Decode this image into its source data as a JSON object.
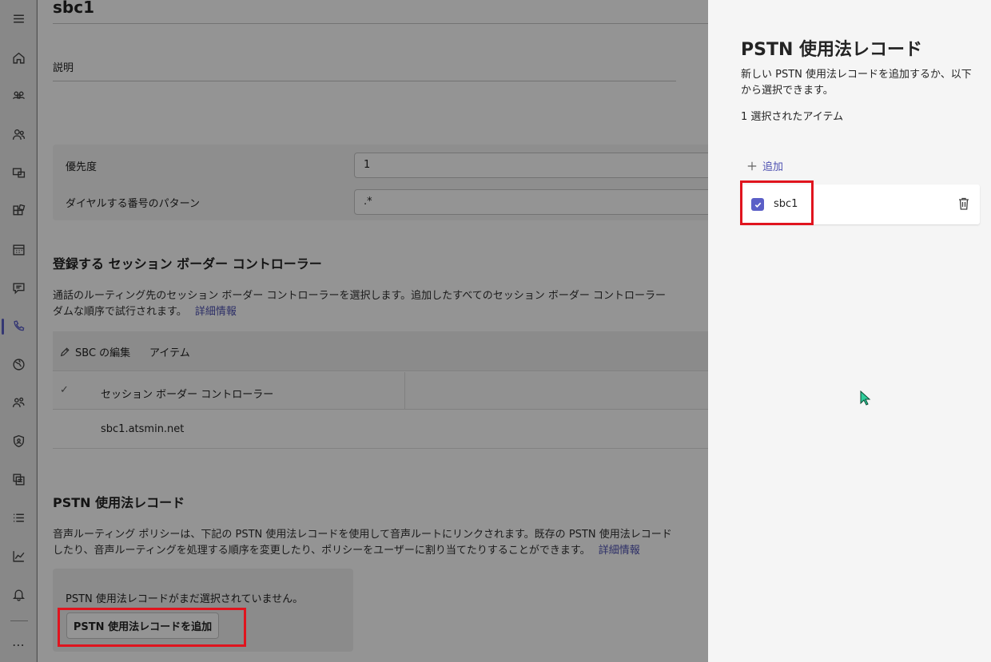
{
  "rail": {
    "items": [
      "menu",
      "home",
      "teams",
      "users",
      "devices",
      "apps",
      "meetings",
      "messaging",
      "voice",
      "locations",
      "enhanced-users",
      "security",
      "planning",
      "reports",
      "analytics",
      "notifications",
      "more"
    ],
    "active": "voice",
    "more_label": "⋯"
  },
  "page": {
    "title": "sbc1",
    "description_label": "説明",
    "priority_label": "優先度",
    "priority_value": "1",
    "pattern_label": "ダイヤルする番号のパターン",
    "pattern_value": ".*"
  },
  "sbc_section": {
    "heading": "登録する セッション ボーダー コントローラー",
    "para_line1": "通話のルーティング先のセッション ボーダー コントローラーを選択します。追加したすべてのセッション ボーダー コントローラー",
    "para_line2": "ダムな順序で試行されます。",
    "learn_more": "詳細情報",
    "edit_label": "SBC の編集",
    "items_label": "アイテム",
    "column_header": "セッション ボーダー コントローラー",
    "check_glyph": "✓",
    "rows": [
      "sbc1.atsmin.net"
    ]
  },
  "pstn_section": {
    "heading": "PSTN 使用法レコード",
    "para_line1": "音声ルーティング ポリシーは、下記の PSTN 使用法レコードを使用して音声ルートにリンクされます。既存の PSTN 使用法レコード",
    "para_line2": "したり、音声ルーティングを処理する順序を変更したり、ポリシーをユーザーに割り当てたりすることができます。",
    "learn_more": "詳細情報",
    "empty_text": "PSTN 使用法レコードがまだ選択されていません。",
    "add_button": "PSTN 使用法レコードを追加"
  },
  "panel": {
    "title": "PSTN 使用法レコード",
    "description": "新しい PSTN 使用法レコードを追加するか、以下から選択できます。",
    "selected_count": "1 選択されたアイテム",
    "add_label": "追加",
    "items": [
      {
        "label": "sbc1",
        "checked": true
      }
    ]
  },
  "colors": {
    "accent": "#5b5fc7",
    "link": "#4f52b2",
    "highlight": "#e0141e",
    "cursor": "#2ecc9a"
  }
}
